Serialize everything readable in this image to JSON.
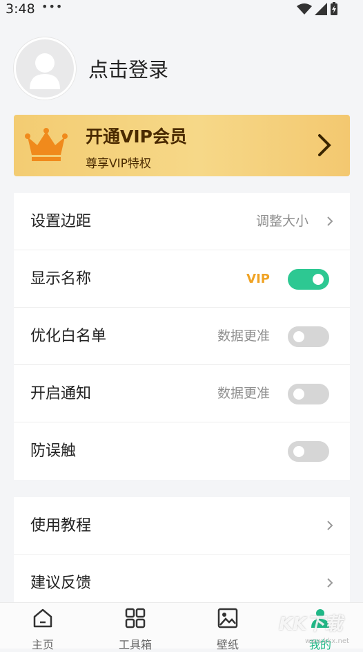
{
  "status": {
    "time": "3:48",
    "dots": "•••"
  },
  "profile": {
    "login_label": "点击登录"
  },
  "vip_banner": {
    "title": "开通VIP会员",
    "subtitle": "尊享VIP特权"
  },
  "settings": [
    {
      "label": "设置边距",
      "value": "调整大小"
    },
    {
      "label": "显示名称",
      "badge": "VIP",
      "toggle_on": true
    },
    {
      "label": "优化白名单",
      "hint": "数据更准",
      "toggle_on": false
    },
    {
      "label": "开启通知",
      "hint": "数据更准",
      "toggle_on": false
    },
    {
      "label": "防误触",
      "toggle_on": false
    }
  ],
  "more": [
    {
      "label": "使用教程"
    },
    {
      "label": "建议反馈"
    }
  ],
  "tabs": [
    {
      "label": "主页",
      "icon": "home-icon"
    },
    {
      "label": "工具箱",
      "icon": "grid-icon"
    },
    {
      "label": "壁纸",
      "icon": "image-icon"
    },
    {
      "label": "我的",
      "icon": "person-icon",
      "active": true
    }
  ],
  "watermark": {
    "text": "KK下载",
    "sub": "www.kkx.net"
  },
  "colors": {
    "accent": "#2dc892",
    "vip_text": "#f0a324",
    "banner": "#f5d27e",
    "banner_text": "#4a2a00"
  }
}
